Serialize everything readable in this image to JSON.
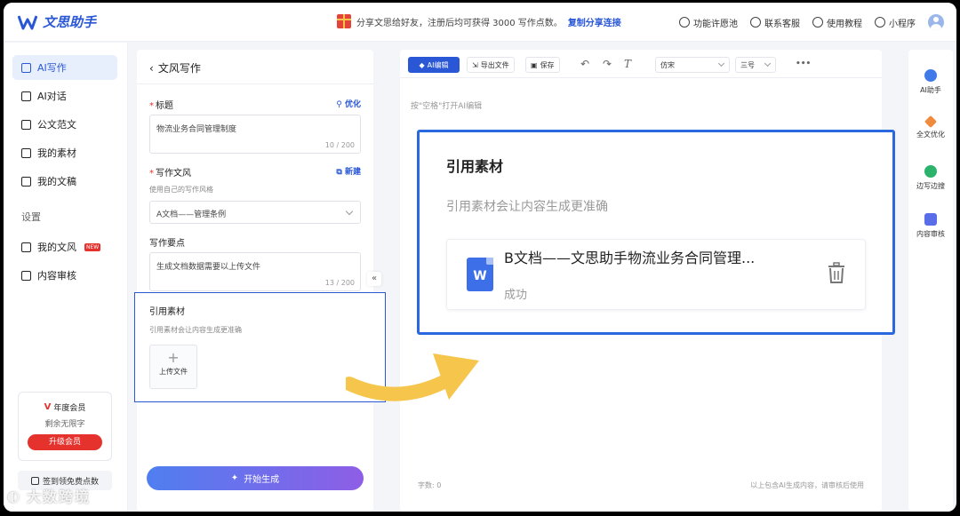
{
  "app": {
    "name": "文思助手",
    "brand_color": "#2a57d6"
  },
  "promo": {
    "text": "分享文思给好友，注册后均可获得 3000 写作点数。",
    "link": "复制分享连接"
  },
  "top_nav": [
    {
      "label": "功能许愿池",
      "icon": "heart-icon"
    },
    {
      "label": "联系客服",
      "icon": "headset-icon"
    },
    {
      "label": "使用教程",
      "icon": "lightbulb-icon"
    },
    {
      "label": "小程序",
      "icon": "miniprogram-icon"
    }
  ],
  "sidebar": {
    "items": [
      {
        "label": "AI写作",
        "icon": "pen-icon",
        "active": true
      },
      {
        "label": "AI对话",
        "icon": "chat-icon",
        "active": false
      },
      {
        "label": "公文范文",
        "icon": "document-icon",
        "active": false
      },
      {
        "label": "我的素材",
        "icon": "folder-icon",
        "active": false
      },
      {
        "label": "我的文稿",
        "icon": "file-icon",
        "active": false
      }
    ],
    "section_label": "设置",
    "settings_items": [
      {
        "label": "我的文风",
        "icon": "pen-icon",
        "badge": "NEW"
      },
      {
        "label": "内容审核",
        "icon": "check-square-icon"
      }
    ],
    "membership": {
      "title": "年度会员",
      "subtitle": "剩余无限字",
      "upgrade_label": "升级会员"
    },
    "signin_label": "签到领免费点数"
  },
  "form": {
    "back_title": "文风写作",
    "title_field": {
      "label": "标题",
      "action": "优化",
      "value": "物流业务合同管理制度",
      "counter": "10 / 200"
    },
    "style_field": {
      "label": "写作文风",
      "action": "新建",
      "hint": "使用自己的写作风格",
      "selected": "A文档——管理条例"
    },
    "points_field": {
      "label": "写作要点",
      "value": "生成文档数据需要以上传文件",
      "counter": "13 / 200"
    },
    "reference": {
      "label": "引用素材",
      "hint": "引用素材会让内容生成更准确",
      "upload_label": "上传文件"
    },
    "generate_label": "开始生成"
  },
  "editor": {
    "toolbar": {
      "ai_edit": "AI编辑",
      "export": "导出文件",
      "save": "保存",
      "font": "仿宋",
      "size": "三号",
      "more": "•••"
    },
    "placeholder": "按\"空格\"打开AI编辑",
    "word_count": "字数: 0",
    "disclaimer": "以上包含AI生成内容，请审核后使用"
  },
  "zoom_card": {
    "title": "引用素材",
    "hint": "引用素材会让内容生成更准确",
    "file_name": "B文档——文思助手物流业务合同管理...",
    "file_status": "成功",
    "file_type": "W"
  },
  "right_rail": [
    {
      "label": "AI助手",
      "color": "#3f7ae8"
    },
    {
      "label": "全文优化",
      "color": "#f08a3c"
    },
    {
      "label": "边写边搜",
      "color": "#2bb36b"
    },
    {
      "label": "内容审核",
      "color": "#5a6de8"
    }
  ],
  "watermark": "大数跨境"
}
